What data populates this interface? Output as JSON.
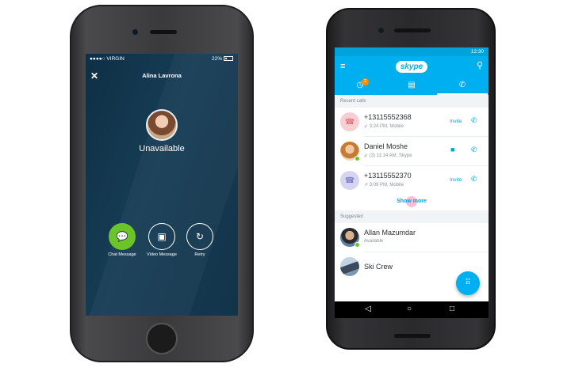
{
  "ios": {
    "status": {
      "carrier": "●●●●○ VIRGIN",
      "time": "",
      "battery": "22%"
    },
    "close_icon": "✕",
    "contact_name": "Alina Lavrona",
    "call_status": "Unavailable",
    "actions": [
      {
        "icon": "chat-icon",
        "glyph": "💬",
        "label": "Chat Message"
      },
      {
        "icon": "video-message-icon",
        "glyph": "▣",
        "label": "Video Message"
      },
      {
        "icon": "retry-icon",
        "glyph": "↻",
        "label": "Retry"
      }
    ]
  },
  "android": {
    "status": {
      "time": "12:30"
    },
    "appbar": {
      "logo": "skype",
      "menu_glyph": "≡",
      "search_glyph": "⚲"
    },
    "tabs": [
      {
        "icon": "recent-icon",
        "glyph": "◷",
        "badge": "2"
      },
      {
        "icon": "contacts-icon",
        "glyph": "▤"
      },
      {
        "icon": "calls-icon",
        "glyph": "✆",
        "active": true
      }
    ],
    "recent_header": "Recent calls",
    "recent_calls": [
      {
        "name": "+13115552368",
        "sub": "↙ 3:24 PM, Mobile",
        "action": "Invite"
      },
      {
        "name": "Daniel Moshe",
        "sub": "↙ (3) 11:14 AM, Skype",
        "action": "video"
      },
      {
        "name": "+13115552370",
        "sub": "↗ 3:09 PM, Mobile",
        "action": "Invite"
      }
    ],
    "show_more": "Show more",
    "suggested_header": "Suggested",
    "suggested": [
      {
        "name": "Allan Mazumdar",
        "sub": "Available"
      },
      {
        "name": "Ski Crew",
        "sub": ""
      }
    ],
    "fab_glyph": "⠿",
    "nav": {
      "back": "◁",
      "home": "○",
      "recent": "□"
    },
    "colors": {
      "accent": "#00aff0",
      "presence": "#6cc42b"
    }
  }
}
